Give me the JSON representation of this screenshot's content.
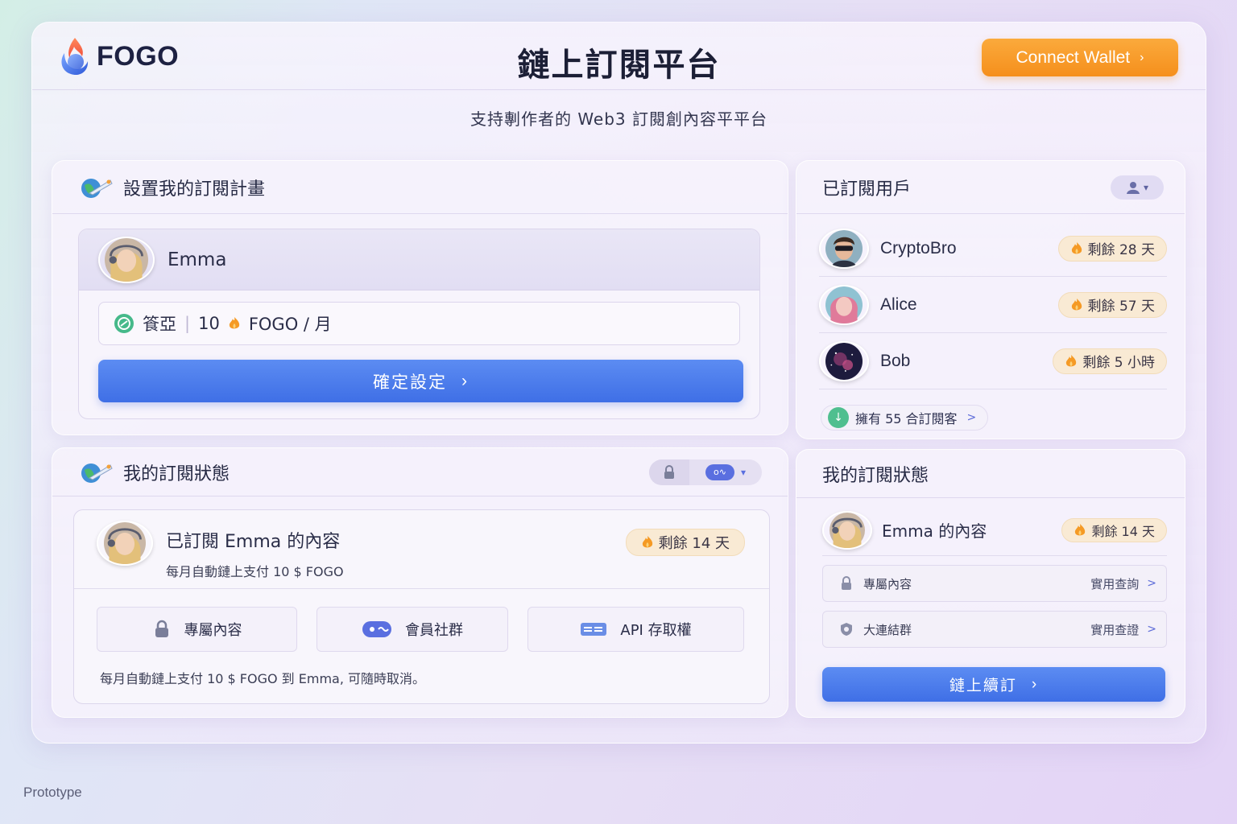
{
  "brand": {
    "name": "FOGO"
  },
  "header": {
    "title": "鏈上訂閱平台",
    "subtitle": "支持剸作者的 Web3 訂閱創內容平平台",
    "connect_label": "Connect Wallet",
    "connect_chevron": "›"
  },
  "setup": {
    "heading": "設置我的訂閱計畫",
    "creator_name": "Emma",
    "price_label": "篒亞",
    "price_amount": "10",
    "price_unit": "FOGO / 月",
    "confirm_label": "確定設定",
    "confirm_chevron": "›"
  },
  "subscribers": {
    "heading": "已訂閱用戶",
    "filter_caret": "▾",
    "items": [
      {
        "name": "CryptoBro",
        "remaining": "剩餘 28 天"
      },
      {
        "name": "Alice",
        "remaining": "剩餘 57 天"
      },
      {
        "name": "Bob",
        "remaining": "剩餘 5 小時"
      }
    ],
    "holder_text": "擁有 55 合訂閱客",
    "holder_chevron": ">"
  },
  "status": {
    "heading": "我的訂閱狀態",
    "subscribed_title": "已訂閱 Emma 的內容",
    "subscribed_sub": "每月自動鏈上支付 10 $ FOGO",
    "remaining": "剩餘 14 天",
    "features": [
      {
        "label": "專屬內容"
      },
      {
        "label": "會員社群"
      },
      {
        "label": "API 存取權"
      }
    ],
    "footnote": "每月自動鏈上支付 10 $ FOGO 到 Emma, 可隨時取消。",
    "link_glyph": "o∿",
    "caret": "▾"
  },
  "my_status": {
    "heading": "我的訂閱狀態",
    "item_name": "Emma 的內容",
    "remaining": "剩餘 14 天",
    "perms": [
      {
        "label": "專屬內容",
        "action": "實用查詢"
      },
      {
        "label": "大連結群",
        "action": "實用查證"
      }
    ],
    "perm_chevron": ">",
    "subscribe_label": "鏈上續訂",
    "subscribe_chevron": "›"
  },
  "footer": {
    "note": "Prototype"
  },
  "colors": {
    "accent_orange": "#f7a02e",
    "accent_blue": "#4a7bee",
    "badge_bg": "#f9ead4"
  }
}
